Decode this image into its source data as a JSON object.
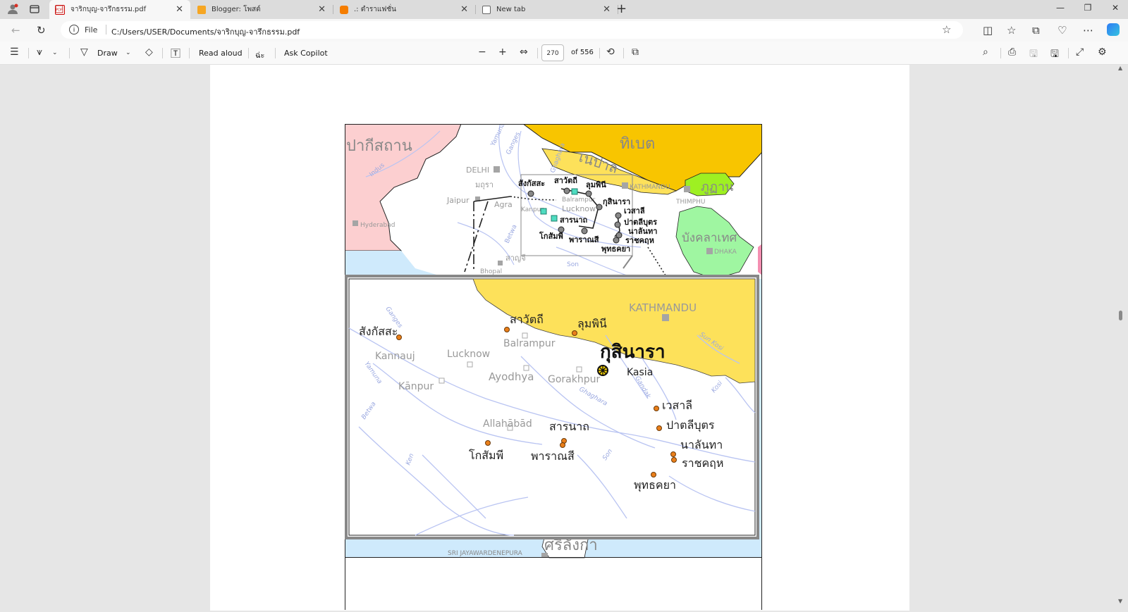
{
  "browser": {
    "tabs": [
      {
        "title": "จาริกบุญ-จารึกธรรม.pdf",
        "active": true
      },
      {
        "title": "Blogger: โพสต์",
        "active": false
      },
      {
        "title": ".: ตำราแฟชั่น",
        "active": false
      },
      {
        "title": "New tab",
        "active": false
      }
    ],
    "address": {
      "scheme_label": "File",
      "url": "C:/Users/USER/Documents/จาริกบุญ-จารึกธรรม.pdf"
    }
  },
  "pdf_toolbar": {
    "draw_label": "Draw",
    "read_aloud_label": "Read aloud",
    "translate_glyph": "ฉ่ะ",
    "ask_copilot_label": "Ask Copilot",
    "current_page": "270",
    "page_total": "of 556"
  },
  "map": {
    "overview": {
      "countries": {
        "pakistan": "ปากีสถาน",
        "tibet": "ทิเบต",
        "nepal": "เนปาล",
        "bhutan": "ภูฏาน",
        "bangladesh": "บังคลาเทศ",
        "srilanka": "ศรีลังกา"
      },
      "cities": {
        "delhi": "DELHI",
        "mathura": "มถุรา",
        "jaipur": "Jaipur",
        "agra": "Agra",
        "hyderabad": "Hyderabad",
        "kathmandu": "KATHMANDU",
        "thimphu": "THIMPHU",
        "dhaka": "DHAKA",
        "bhopal": "Bhopal",
        "sanchi": "สาญจี",
        "lucknow": "Lucknow",
        "kanpur": "Kanpur",
        "balrampur": "Balrampur",
        "colombo": "SRI JAYAWARDENEPURA"
      },
      "sites": {
        "sankassa": "สังกัสสะ",
        "savatthi": "สาวัตถี",
        "lumbini": "ลุมพินี",
        "kusinara": "กุสินารา",
        "vesali": "เวสาลี",
        "pataliputra": "ปาตลีบุตร",
        "nalanda": "นาลันทา",
        "rajagaha": "ราชคฤห",
        "sarnath": "สารนาถ",
        "varanasi": "พาราณสี",
        "kosambi": "โกสัมพี",
        "bodhgaya": "พุทธคยา"
      },
      "rivers": {
        "indus": "Indus",
        "yamuna": "Yamuna",
        "ganges": "Ganges",
        "betwa": "Betwa",
        "son": "Son",
        "ghaghara": "Ghaghara"
      }
    },
    "detail": {
      "kathmandu": "KATHMANDU",
      "sankassa": "สังกัสสะ",
      "savatthi": "สาวัตถี",
      "lumbini": "ลุมพินี",
      "kusinara": "กุสินารา",
      "kasia": "Kasia",
      "kannauj": "Kannauj",
      "lucknow": "Lucknow",
      "balrampur": "Balrampur",
      "ayodhya": "Ayodhya",
      "gorakhpur": "Gorakhpur",
      "kanpur": "Kānpur",
      "vesali": "เวสาลี",
      "pataliputra": "ปาตลีบุตร",
      "nalanda": "นาลันทา",
      "rajagaha": "ราชคฤห",
      "allahabad": "Allahābād",
      "sarnath": "สารนาถ",
      "kosambi": "โกสัมพี",
      "varanasi": "พาราณสี",
      "bodhgaya": "พุทธคยา",
      "rivers": {
        "ganges": "Ganges",
        "yamuna": "Yamuna",
        "betwa": "Betwa",
        "ken": "Ken",
        "son": "Son",
        "ghaghara": "Ghaghara",
        "gandak": "Gandak",
        "kosi": "Kosi",
        "sun_kosi": "Sun Kosi"
      }
    }
  },
  "colors": {
    "pakistan": "#fccfd0",
    "tibet": "#f8c500",
    "nepal": "#fde15a",
    "bhutan": "#9ef022",
    "bangladesh": "#9ff6a1",
    "sea": "#cfeafc",
    "river": "#b9c4f2",
    "site": "#ea7f1a"
  }
}
